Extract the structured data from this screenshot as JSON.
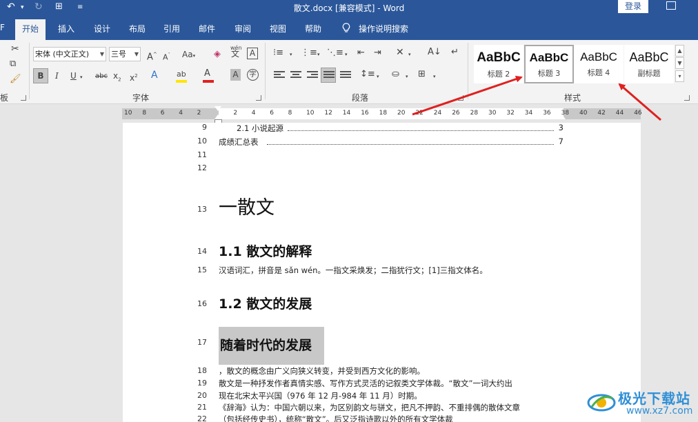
{
  "titlebar": {
    "title": "散文.docx [兼容模式]  -  Word",
    "login_label": "登录",
    "undo_icon": "undo-icon",
    "redo_icon": "redo-icon",
    "touch_icon": "touch-mode-icon",
    "customize_icon": "customize-qat-icon"
  },
  "tabs": {
    "file_partial": "F",
    "home": "开始",
    "insert": "插入",
    "design": "设计",
    "layout": "布局",
    "references": "引用",
    "mailings": "邮件",
    "review": "审阅",
    "view": "视图",
    "help": "帮助",
    "tell_me": "操作说明搜索"
  },
  "ribbon": {
    "clipboard_label_partial": "板",
    "font_name": "宋体 (中文正文)",
    "font_size": "三号",
    "font_group_label": "字体",
    "paragraph_group_label": "段落",
    "styles_group_label": "样式",
    "wen_label": "wén",
    "wen_char": "文",
    "aa_label": "Aa",
    "styles": [
      {
        "sample": "AaBbC",
        "name": "标题 2"
      },
      {
        "sample": "AaBbC",
        "name": "标题 3"
      },
      {
        "sample": "AaBbC",
        "name": "标题 4"
      },
      {
        "sample": "AaBbC",
        "name": "副标题"
      }
    ],
    "selected_style": "标题 3",
    "accent_color": "#2b579a",
    "highlight_color": "#ffe600",
    "font_color": "#e02020"
  },
  "ruler": {
    "left_numbers": [
      "10",
      "8",
      "6",
      "4",
      "2"
    ],
    "right_numbers": [
      "2",
      "4",
      "6",
      "8",
      "10",
      "12",
      "14",
      "16",
      "18",
      "20",
      "22",
      "24",
      "26",
      "28",
      "30",
      "32",
      "34",
      "36",
      "38",
      "40",
      "42",
      "44",
      "46"
    ]
  },
  "document": {
    "lines": [
      {
        "n": "9",
        "text": "2.1 小说起源",
        "page": "3"
      },
      {
        "n": "10",
        "text": "成绩汇总表",
        "page": "7"
      },
      {
        "n": "11",
        "text": ""
      },
      {
        "n": "12",
        "text": ""
      },
      {
        "n": "13",
        "text": "一散文"
      },
      {
        "n": "14",
        "text": "1.1 散文的解释"
      },
      {
        "n": "15",
        "text": "汉语词汇，拼音是 sǎn wén。一指文采焕发；二指犹行文；[1]三指文体名。"
      },
      {
        "n": "16",
        "text": "1.2 散文的发展"
      },
      {
        "n": "17",
        "text": "随着时代的发展"
      },
      {
        "n": "18",
        "text": "，散文的概念由广义向狭义转变，并受到西方文化的影响。"
      },
      {
        "n": "19",
        "text": "散文是一种抒发作者真情实感、写作方式灵活的记叙类文学体裁。“散文”一词大约出"
      },
      {
        "n": "20",
        "text": "现在北宋太平兴国（976 年 12 月-984 年 11 月）时期。"
      },
      {
        "n": "21",
        "text": "《辞海》认为：中国六朝以来，为区别韵文与骈文，把凡不押韵、不重排偶的散体文章"
      },
      {
        "n": "22",
        "text": "（包括经传史书），统称“散文”。后又泛指诗歌以外的所有文学体裁"
      }
    ]
  },
  "watermark": {
    "name": "极光下载站",
    "url": "www.xz7.com"
  },
  "annotation_color": "#e02020"
}
